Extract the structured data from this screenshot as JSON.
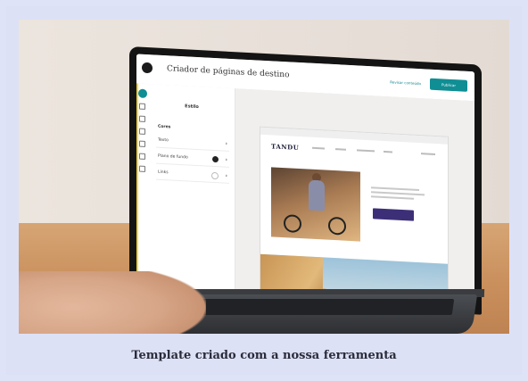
{
  "app": {
    "title": "Criador de páginas de destino",
    "review_label": "Revisar conteúdo",
    "publish_label": "Publicar"
  },
  "panel": {
    "title": "Estilo",
    "section": "Cores",
    "rows": [
      {
        "label": "Texto",
        "swatch": "none"
      },
      {
        "label": "Plano de fundo",
        "swatch": "#222222"
      },
      {
        "label": "Links",
        "swatch": "outline"
      }
    ]
  },
  "preview": {
    "brand": "TANDU"
  },
  "caption": "Template criado com a nossa ferramenta",
  "colors": {
    "accent": "#0f8e94",
    "cta": "#3d2f77",
    "rail_stripe": "#f3d43a",
    "frame_background": "#dfe3f7"
  }
}
